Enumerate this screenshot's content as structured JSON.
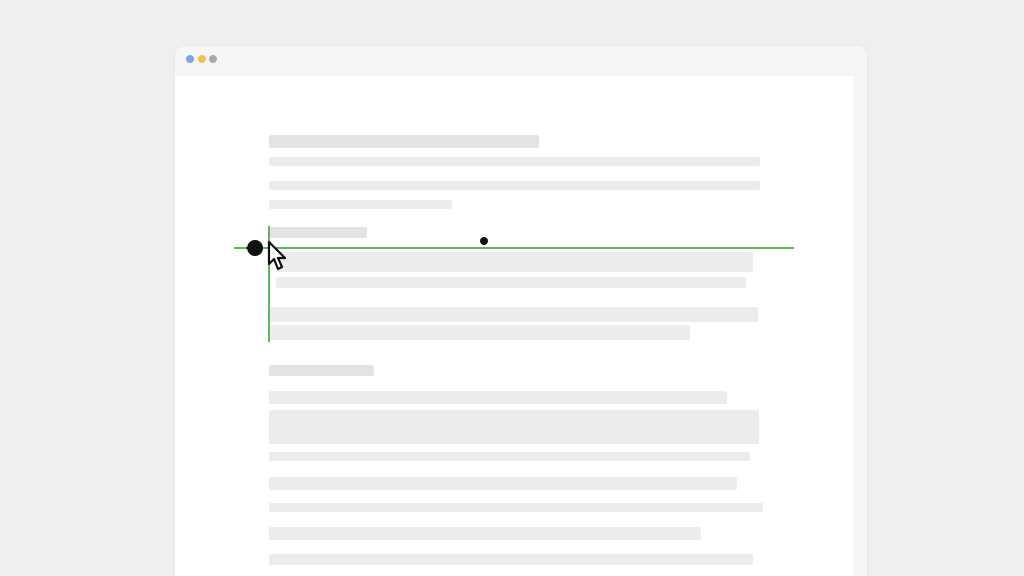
{
  "colors": {
    "page_background": "#efefef",
    "window_background": "#f6f6f6",
    "content_background": "#ffffff",
    "placeholder_heading": "#e3e3e3",
    "placeholder_text": "#ececec",
    "guide_line": "#5cb85c",
    "ink": "#111111",
    "window_dot_blue": "#7aa7e0",
    "window_dot_yellow": "#f0c24b",
    "window_dot_gray": "#a9a9a9"
  },
  "icons": {
    "window_controls": [
      "window-dot-blue-icon",
      "window-dot-yellow-icon",
      "window-dot-gray-icon"
    ],
    "guide_handle": "drag-handle-icon",
    "pointer": "arrow-cursor-icon",
    "marker": "marker-dot-icon"
  }
}
